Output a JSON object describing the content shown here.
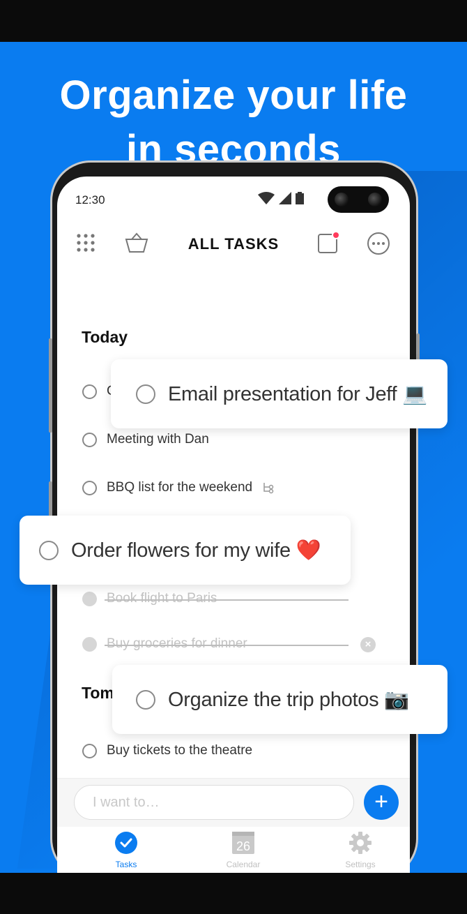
{
  "headline": {
    "line1": "Organize your life",
    "line2": "in seconds"
  },
  "status": {
    "time": "12:30"
  },
  "appbar": {
    "title": "ALL TASKS",
    "icons": [
      "grid-icon",
      "basket-icon",
      "notification-icon",
      "more-icon"
    ]
  },
  "sections": {
    "today": "Today",
    "tomorrow": "Tom"
  },
  "tasks": {
    "t1_partial": "C",
    "t2": "Meeting with Dan",
    "t3": "BBQ list for the weekend",
    "done1": "Book flight to Paris",
    "done2": "Buy groceries for dinner",
    "t4": "Buy tickets to the theatre"
  },
  "cards": {
    "email": "Email presentation for Jeff 💻",
    "flowers": "Order flowers for my wife ❤️",
    "photos": "Organize the trip photos 📷"
  },
  "input": {
    "placeholder": "I want to…"
  },
  "tabs": [
    {
      "label": "Tasks",
      "active": true
    },
    {
      "label": "Calendar",
      "day": "26"
    },
    {
      "label": "Settings"
    }
  ],
  "colors": {
    "accent": "#0a7cf0",
    "badge": "#ff3b5c"
  }
}
